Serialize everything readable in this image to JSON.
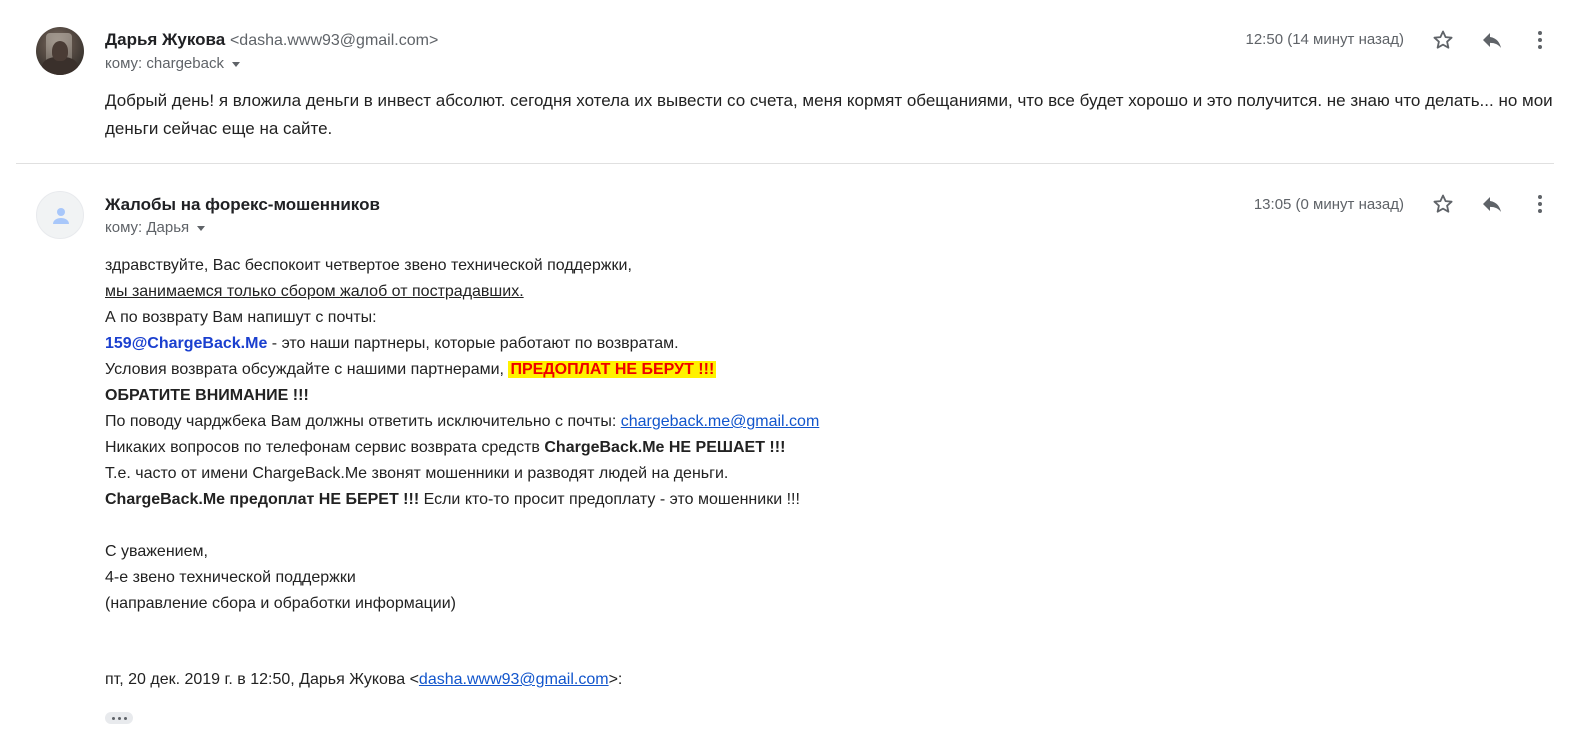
{
  "messages": [
    {
      "sender_name": "Дарья Жукова",
      "sender_email": "<dasha.www93@gmail.com>",
      "to_label": "кому: chargeback",
      "time": "12:50 (14 минут назад)",
      "body": "Добрый день! я вложила деньги в инвест абсолют. сегодня хотела их вывести со счета, меня кормят обещаниями, что все будет хорошо и это получится. не знаю что делать... но мои деньги сейчас еще на сайте."
    },
    {
      "sender_name": "Жалобы на форекс-мошенников",
      "to_label": "кому: Дарья",
      "time": "13:05 (0 минут назад)",
      "lines": {
        "l1": "здравствуйте, Вас беспокоит четвертое звено технической поддержки,",
        "l2": "мы занимаемся только сбором жалоб от пострадавших.",
        "l3": "А по возврату Вам напишут с почты:",
        "l4_email": "159@ChargeBack.Me",
        "l4_rest": " - это наши партнеры, которые работают по возвратам.",
        "l5_text": "Условия возврата обсуждайте с нашими партнерами, ",
        "l5_highlight": "ПРЕДОПЛАТ НЕ БЕРУТ !!!",
        "l6": "ОБРАТИТЕ ВНИМАНИЕ !!!",
        "l7_text": "По поводу чарджбека Вам должны ответить исключительно с почты: ",
        "l7_link": "chargeback.me@gmail.com",
        "l8_text": "Никаких вопросов по телефонам сервис возврата средств ",
        "l8_bold": "ChargeBack.Me НЕ РЕШАЕТ !!!",
        "l9": "Т.е. часто от имени ChargeBack.Me звонят мошенники и разводят людей на деньги.",
        "l10_bold": "ChargeBack.Me предоплат НЕ БЕРЕТ !!!",
        "l10_rest": " Если кто-то просит предоплату - это мошенники !!!",
        "sig1": "С уважением,",
        "sig2": "4-е звено технической поддержки",
        "sig3": "(направление сбора и обработки информации)"
      },
      "quote_prefix": "пт, 20 дек. 2019 г. в 12:50, Дарья Жукова <",
      "quote_link": "dasha.www93@gmail.com",
      "quote_suffix": ">:"
    }
  ],
  "icons": [
    "star-icon",
    "reply-icon",
    "more-vert-icon",
    "person-icon",
    "expand-dots-icon"
  ],
  "colors": {
    "highlight_bg": "#fff200",
    "highlight_text": "#e00000",
    "link": "#1155cc",
    "partner_email": "#1a3fcf",
    "muted": "#5f6368"
  }
}
